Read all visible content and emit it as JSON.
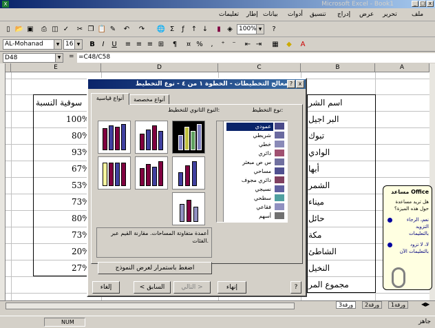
{
  "window": {
    "title": "Microsoft Excel - Book1",
    "controls": [
      "_",
      "□",
      "x"
    ]
  },
  "menu": [
    "ملف",
    "تحرير",
    "عرض",
    "إدراج",
    "تنسيق",
    "أدوات",
    "بيانات",
    "إطار",
    "تعليمات"
  ],
  "toolbar": {
    "zoom": "100%"
  },
  "format": {
    "font": "AL-Mohanad",
    "size": "16",
    "bold": "B",
    "italic": "I",
    "underline": "U",
    "percent": "%"
  },
  "formula": {
    "cell_ref": "D48",
    "eq": "=",
    "content": "=C48/C58"
  },
  "columns": [
    "E",
    "D",
    "C",
    "B",
    "A"
  ],
  "sheet": {
    "left_header": "سوقية النسبة",
    "left_values": [
      "100%",
      "80%",
      "93%",
      "67%",
      "53%",
      "73%",
      "80%",
      "73%",
      "20%",
      "27%"
    ],
    "right_values": [
      "اسم الشر",
      "البر اجيل",
      "تبوك",
      "الوادي",
      "أبها",
      "الشمر",
      "ميناء",
      "حائل",
      "مكة",
      "الشاطئ",
      "النخيل",
      "مجموع المر"
    ]
  },
  "dialog": {
    "title": "معالج التخطيطات - الخطوة ١ من ٤ - نوع التخطيط",
    "help": "?",
    "close": "x",
    "tabs": [
      "أنواع قياسية",
      "أنواع مخصصة"
    ],
    "chart_type_label": "نوع التخطيط:",
    "subtype_label": "النوع الثانوي للتخطيط:",
    "chart_types": [
      "عمودي",
      "شريطي",
      "خطي",
      "دائري",
      "س ص مبعثر",
      "مساحي",
      "دائري مجوف",
      "نسيجي",
      "سطحي",
      "فقاعي",
      "أسهم"
    ],
    "selected_index": 0,
    "description": "أعمدة متفاوتة المساحات. مقارنة القيم عبر الفئات.",
    "preview_button": "اضغط باستمرار لعرض النموذج",
    "buttons": {
      "cancel": "إلغاء",
      "back": "< السابق",
      "next": "التالي >",
      "finish": "إنهاء",
      "help": "?"
    }
  },
  "assistant": {
    "title": "مساعد Office",
    "question": "هل تريد مساعدة حول هذه الميزة؟",
    "opt1": "نعم، الرجاء التزويد بالتعليمات",
    "opt2": "لا، لا تزود بالتعليمات الآن"
  },
  "sheet_tabs": [
    "ورقة1",
    "ورقة2",
    "ورقة3"
  ],
  "status": {
    "num": "NUM",
    "ready": "جاهز"
  }
}
